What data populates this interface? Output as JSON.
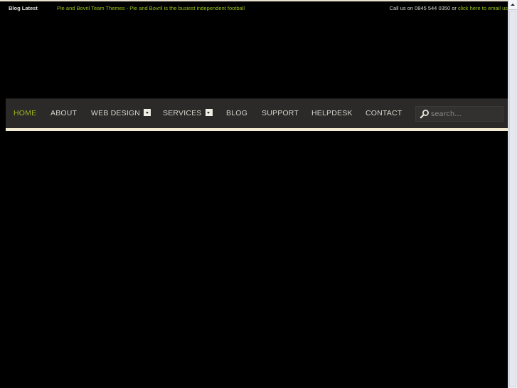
{
  "topbar": {
    "blog_label": "Blog Latest",
    "ticker_text": "Pie and Bovril Team Themes - Pie and Bovril is the busiest independent football",
    "contact_prefix": "Call us on 0845 544 0350 or ",
    "contact_link": "click here to email us"
  },
  "nav": {
    "items": [
      {
        "label": "HOME",
        "active": true
      },
      {
        "label": "ABOUT"
      },
      {
        "label": "WEB DESIGN",
        "dropdown": true
      },
      {
        "label": "SERVICES",
        "dropdown": true
      },
      {
        "label": "BLOG"
      },
      {
        "label": "SUPPORT"
      },
      {
        "label": "HELPDESK"
      },
      {
        "label": "CONTACT"
      }
    ],
    "search": {
      "placeholder": "search...",
      "value": "",
      "icon": "search-icon"
    }
  },
  "colors": {
    "accent": "#9bc41a",
    "nav_bg": "#2b2a28",
    "nav_border": "#f3ead2",
    "page_bg": "#000000"
  }
}
